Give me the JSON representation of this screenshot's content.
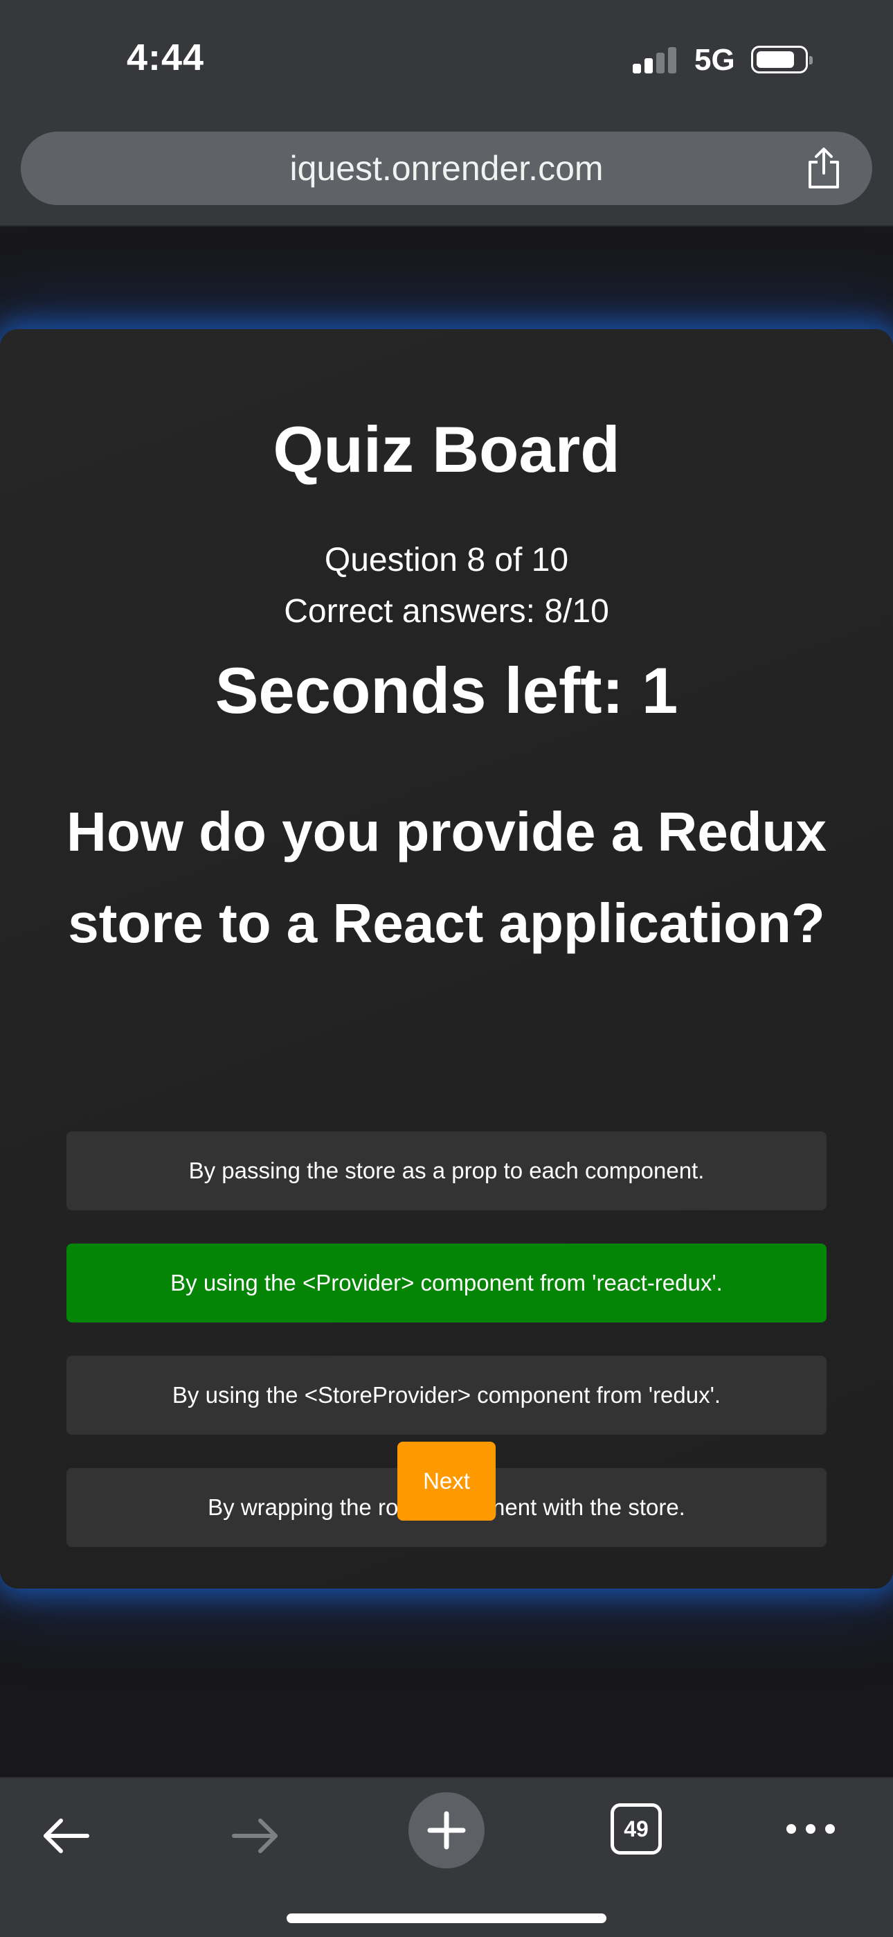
{
  "status_bar": {
    "time": "4:44",
    "network": "5G",
    "signal_bars_active": 2,
    "signal_bars_total": 4
  },
  "browser": {
    "url": "iquest.onrender.com",
    "tab_count": "49"
  },
  "quiz": {
    "title": "Quiz Board",
    "progress": "Question 8 of 10",
    "correct": "Correct answers: 8/10",
    "timer": "Seconds left: 1",
    "question": "How do you provide a Redux store to a React application?",
    "answers": [
      "By passing the store as a prop to each component.",
      "By using the <Provider> component from 'react-redux'.",
      "By using the <StoreProvider> component from 'redux'.",
      "By wrapping the root component with the store."
    ],
    "highlighted_answer_index": 1,
    "next_label": "Next"
  },
  "colors": {
    "correct_answer": "#058506",
    "next_button": "#ff9900",
    "card_glow": "#1e78ff"
  },
  "icons": {
    "share": "share-icon",
    "back": "arrow-left-icon",
    "forward": "arrow-right-icon",
    "new_tab": "plus-icon",
    "more": "ellipsis-icon"
  }
}
